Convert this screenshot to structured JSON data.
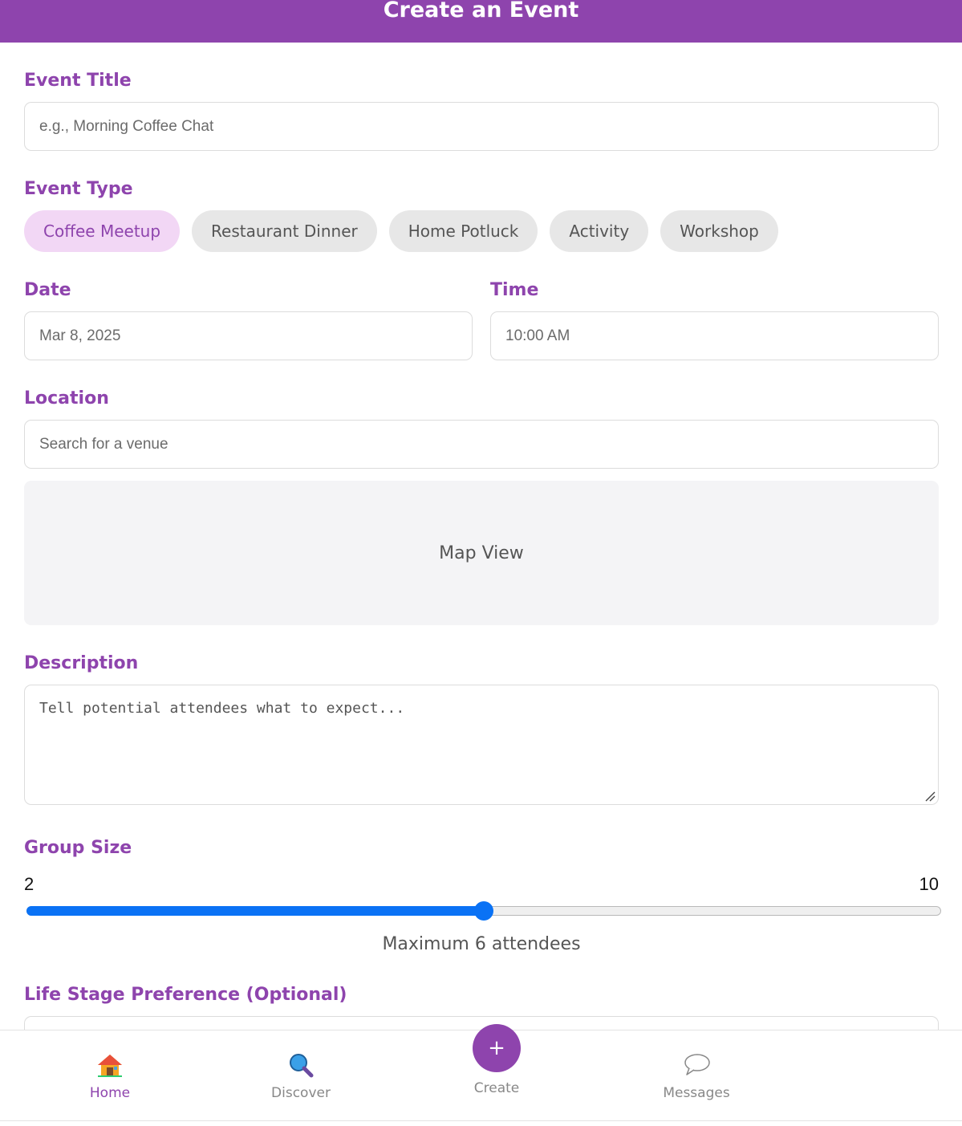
{
  "header": {
    "title": "Create an Event"
  },
  "form": {
    "title": {
      "label": "Event Title",
      "placeholder": "e.g., Morning Coffee Chat",
      "value": ""
    },
    "type": {
      "label": "Event Type",
      "options": [
        "Coffee Meetup",
        "Restaurant Dinner",
        "Home Potluck",
        "Activity",
        "Workshop"
      ],
      "selected": "Coffee Meetup"
    },
    "date": {
      "label": "Date",
      "value": "Mar 8, 2025"
    },
    "time": {
      "label": "Time",
      "value": "10:00 AM"
    },
    "location": {
      "label": "Location",
      "placeholder": "Search for a venue",
      "map_label": "Map View"
    },
    "description": {
      "label": "Description",
      "placeholder": "Tell potential attendees what to expect..."
    },
    "group_size": {
      "label": "Group Size",
      "min": "2",
      "max": "10",
      "value": 6,
      "caption": "Maximum 6 attendees"
    },
    "life_stage": {
      "label": "Life Stage Preference (Optional)"
    }
  },
  "nav": {
    "home": "Home",
    "discover": "Discover",
    "create_symbol": "+",
    "create": "Create",
    "messages": "Messages"
  },
  "colors": {
    "accent": "#8e44ad",
    "slider": "#0a72f5",
    "chip_selected_bg": "#f2d7f5"
  }
}
